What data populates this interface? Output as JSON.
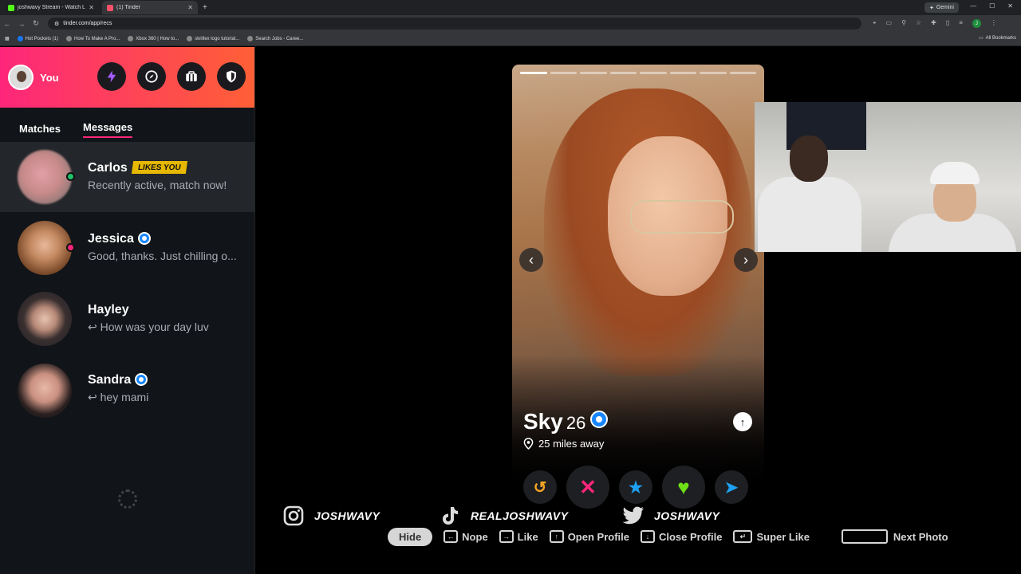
{
  "browser": {
    "tabs": [
      {
        "title": "joshwavy Stream - Watch Live o",
        "active": false,
        "color": "#53fc18"
      },
      {
        "title": "(1) Tinder",
        "active": true,
        "color": "#fd5068"
      }
    ],
    "gemini_label": "Gemini",
    "url": "tinder.com/app/recs",
    "bookmarks": [
      "Hot Pockets (1)",
      "How To Make A Pro...",
      "Xbox 360 | How to...",
      "skrillex logo tutorial...",
      "Search Jobs - Caree..."
    ],
    "all_bookmarks": "All Bookmarks",
    "profile_initial": "J"
  },
  "sidebar": {
    "you_label": "You",
    "tabs": [
      "Matches",
      "Messages"
    ],
    "conversations": [
      {
        "name": "Carlos",
        "badge": "LIKES YOU",
        "message": "Recently active, match now!",
        "online_color": "#1ec26a",
        "verified": false
      },
      {
        "name": "Jessica",
        "badge": "",
        "message": "Good, thanks. Just chilling o...",
        "online_color": "#fd267a",
        "verified": true
      },
      {
        "name": "Hayley",
        "badge": "",
        "message": "↩ How was your day luv",
        "online_color": "",
        "verified": false
      },
      {
        "name": "Sandra",
        "badge": "",
        "message": "↩ hey mami",
        "online_color": "",
        "verified": true
      }
    ]
  },
  "card": {
    "name": "Sky",
    "age": "26",
    "distance": "25 miles away",
    "photo_index": 1,
    "photo_count": 8
  },
  "actions": [
    {
      "icon": "rewind-icon",
      "glyph": "↺",
      "color": "#f5a623"
    },
    {
      "icon": "nope-icon",
      "glyph": "✕",
      "color": "#fd267a"
    },
    {
      "icon": "super-like-icon",
      "glyph": "★",
      "color": "#1ea0f2"
    },
    {
      "icon": "like-icon",
      "glyph": "♥",
      "color": "#6ee016"
    },
    {
      "icon": "boost-icon",
      "glyph": "➤",
      "color": "#1ea0f2"
    }
  ],
  "socials": [
    {
      "platform": "instagram",
      "handle": "JOSHWAVY"
    },
    {
      "platform": "tiktok",
      "handle": "REALJOSHWAVY"
    },
    {
      "platform": "twitter",
      "handle": "JOSHWAVY"
    }
  ],
  "shortcuts": {
    "hide": "Hide",
    "nope": "Nope",
    "like": "Like",
    "open_profile": "Open Profile",
    "close_profile": "Close Profile",
    "super_like": "Super Like",
    "next_photo": "Next Photo"
  }
}
